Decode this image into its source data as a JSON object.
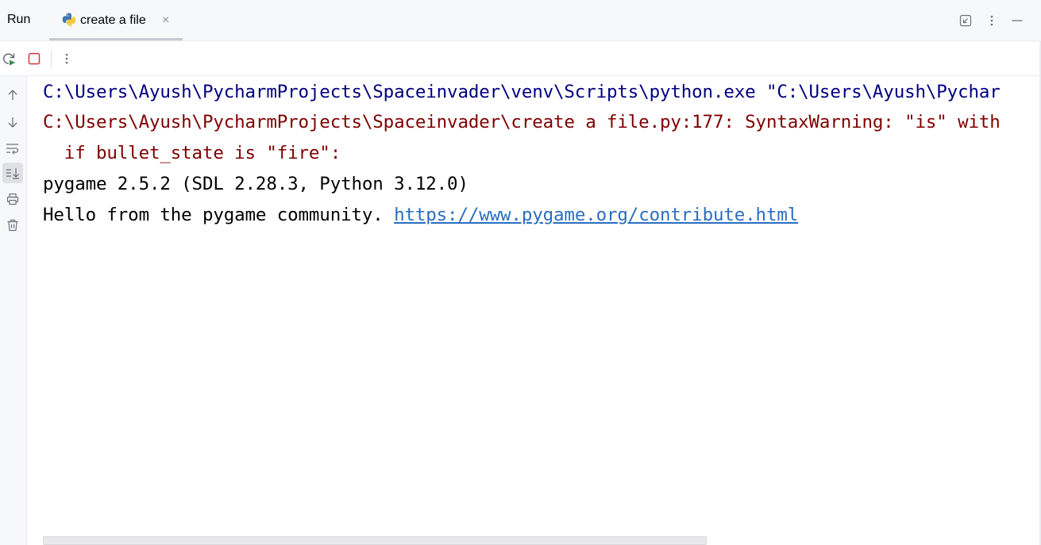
{
  "header": {
    "run_label": "Run",
    "tab": {
      "label": "create a file",
      "close": "×"
    }
  },
  "icons": {
    "tab_icon": "python-icon",
    "restore": "restore-layout-icon",
    "more": "more-vertical-icon",
    "minimize": "minimize-icon",
    "rerun": "rerun-icon",
    "stop": "stop-icon",
    "toolbar_more": "more-vertical-icon",
    "gutter": [
      "arrow-up-icon",
      "arrow-down-icon",
      "soft-wrap-icon",
      "scroll-to-end-icon",
      "print-icon",
      "trash-icon"
    ]
  },
  "console": {
    "lines": [
      {
        "text": "C:\\Users\\Ayush\\PycharmProjects\\Spaceinvader\\venv\\Scripts\\python.exe \"C:\\Users\\Ayush\\Pychar"
      },
      {
        "text": "C:\\Users\\Ayush\\PycharmProjects\\Spaceinvader\\create a file.py:177: SyntaxWarning: \"is\" with"
      },
      {
        "text": "  if bullet_state is \"fire\":"
      },
      {
        "text": "pygame 2.5.2 (SDL 2.28.3, Python 3.12.0)"
      },
      {
        "text": "Hello from the pygame community. ",
        "link": "https://www.pygame.org/contribute.html"
      }
    ]
  },
  "colors": {
    "command": "#000080",
    "error": "#7f0000",
    "output": "#000000",
    "link": "#2a6ebf",
    "stop": "#d9323c",
    "rerun_accent": "#3e8a4a"
  }
}
